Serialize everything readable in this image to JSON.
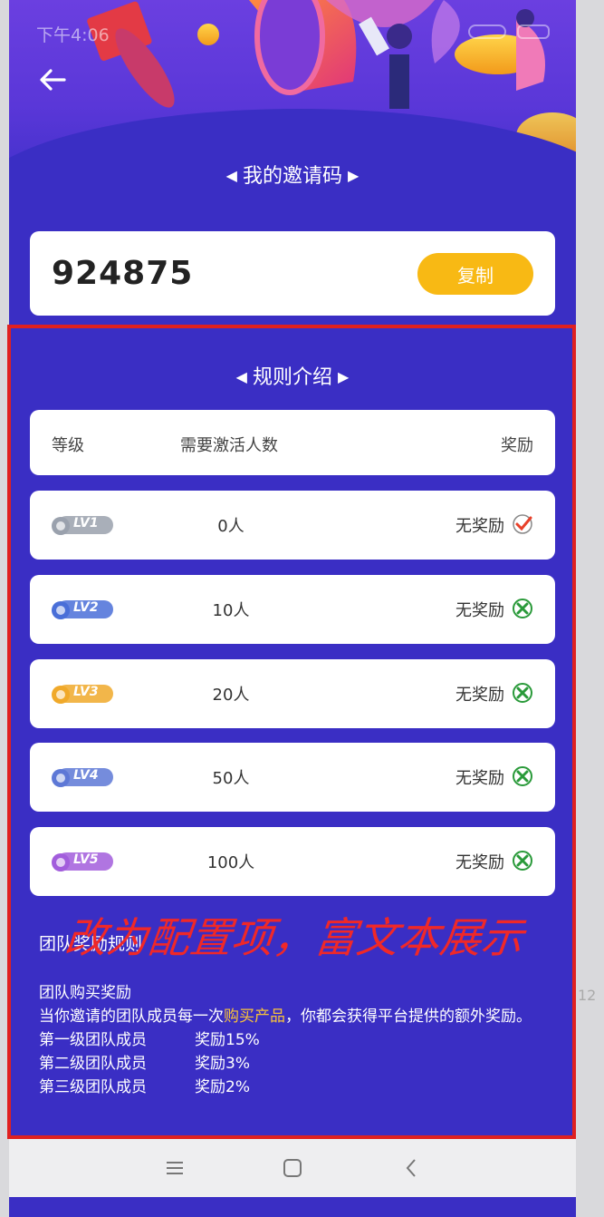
{
  "status": {
    "time": "下午4:06"
  },
  "header": {
    "title": "我的邀请码"
  },
  "invite": {
    "code": "924875",
    "copy_label": "复制"
  },
  "rules": {
    "title": "规则介绍",
    "columns": {
      "level": "等级",
      "need": "需要激活人数",
      "reward": "奖励"
    },
    "rows": [
      {
        "level": "LV1",
        "count": "0人",
        "reward": "无奖励",
        "status_icon": "check-icon",
        "badge_color": "#9aa1ad"
      },
      {
        "level": "LV2",
        "count": "10人",
        "reward": "无奖励",
        "status_icon": "cross-icon",
        "badge_color": "#4a6fd8"
      },
      {
        "level": "LV3",
        "count": "20人",
        "reward": "无奖励",
        "status_icon": "cross-icon",
        "badge_color": "#f0a92a"
      },
      {
        "level": "LV4",
        "count": "50人",
        "reward": "无奖励",
        "status_icon": "cross-icon",
        "badge_color": "#5d78d6"
      },
      {
        "level": "LV5",
        "count": "100人",
        "reward": "无奖励",
        "status_icon": "cross-icon",
        "badge_color": "#a25ddc"
      }
    ]
  },
  "annotation": "改为配置项，富文本展示",
  "team": {
    "title": "团队奖励规则",
    "subtitle": "团队购买奖励",
    "desc_before": "当你邀请的团队成员每一次",
    "desc_highlight": "购买产品",
    "desc_after": "，你都会获得平台提供的额外奖励。",
    "tiers": [
      {
        "name": "第一级团队成员",
        "reward": "奖励15%"
      },
      {
        "name": "第二级团队成员",
        "reward": "奖励3%"
      },
      {
        "name": "第三级团队成员",
        "reward": "奖励2%"
      }
    ]
  },
  "side_text": "12",
  "colors": {
    "primary": "#3a2ec4",
    "accent": "#f8b914",
    "annotation": "#e02020",
    "highlight": "#f8c23a"
  }
}
